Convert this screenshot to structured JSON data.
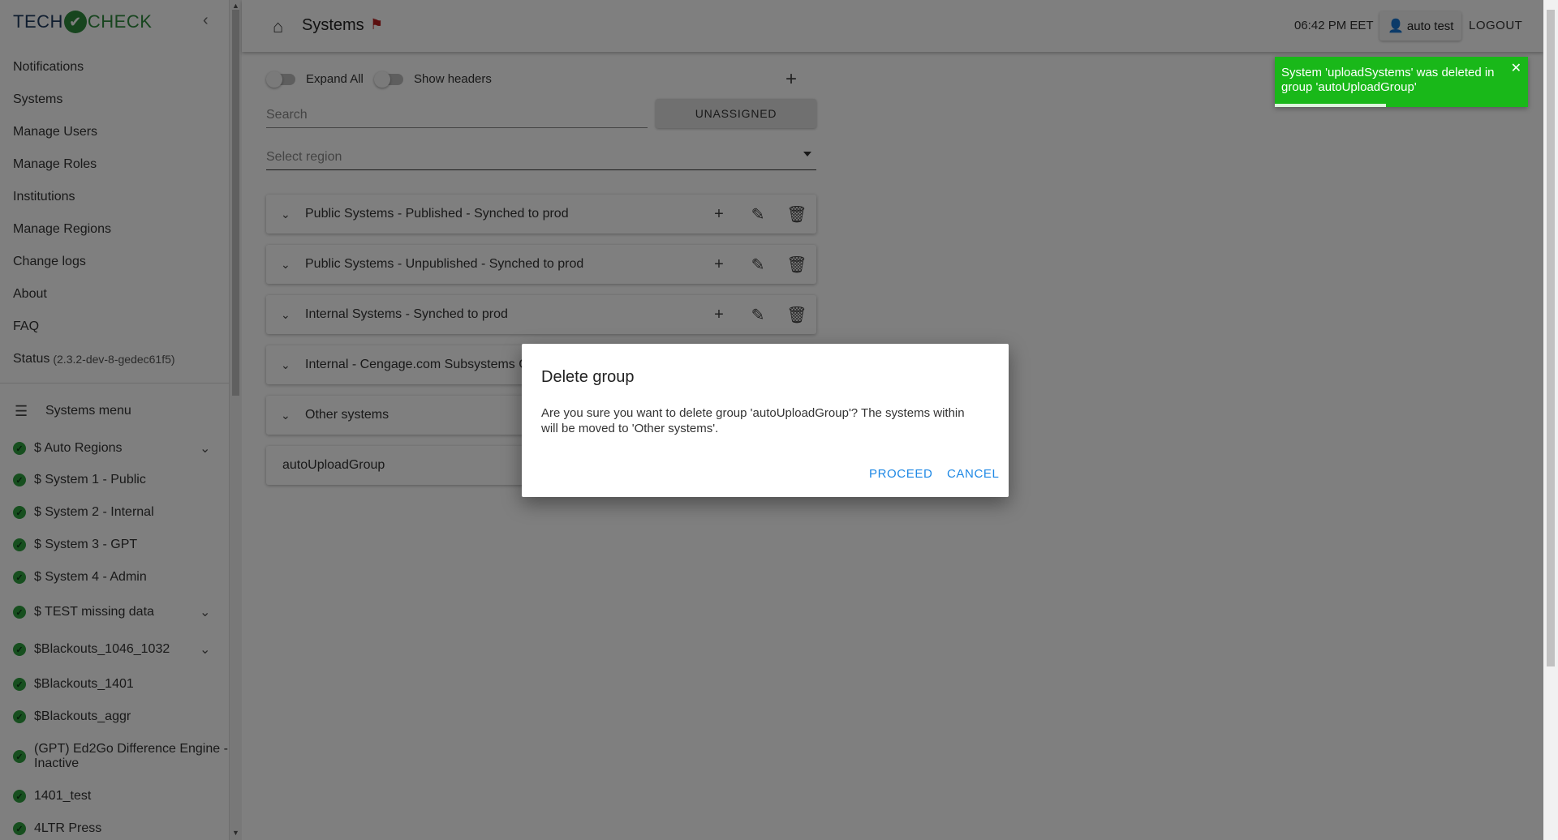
{
  "brand": {
    "part1": "TECH",
    "part2": "CHECK",
    "check_glyph": "✔"
  },
  "sidebar": {
    "nav": [
      {
        "label": "Notifications"
      },
      {
        "label": "Systems"
      },
      {
        "label": "Manage Users"
      },
      {
        "label": "Manage Roles"
      },
      {
        "label": "Institutions"
      },
      {
        "label": "Manage Regions"
      },
      {
        "label": "Change logs"
      },
      {
        "label": "About"
      },
      {
        "label": "FAQ"
      },
      {
        "label": "Status",
        "sub": "(2.3.2-dev-8-gedec61f5)"
      }
    ],
    "systems_menu_label": "Systems menu",
    "systems": [
      {
        "label": "$ Auto Regions",
        "expandable": true
      },
      {
        "label": "$ System 1 - Public",
        "expandable": false
      },
      {
        "label": "$ System 2 - Internal",
        "expandable": false
      },
      {
        "label": "$ System 3 - GPT",
        "expandable": false
      },
      {
        "label": "$ System 4 - Admin",
        "expandable": false
      },
      {
        "label": "$ TEST missing data",
        "expandable": true
      },
      {
        "label": "$Blackouts_1046_1032",
        "expandable": true
      },
      {
        "label": "$Blackouts_1401",
        "expandable": false
      },
      {
        "label": "$Blackouts_aggr",
        "expandable": false
      },
      {
        "label": "(GPT) Ed2Go Difference Engine - Inactive",
        "expandable": false
      },
      {
        "label": "1401_test",
        "expandable": false
      },
      {
        "label": "4LTR Press",
        "expandable": false
      }
    ]
  },
  "header": {
    "title": "Systems",
    "time": "06:42 PM EET",
    "user": "auto test",
    "logout": "LOGOUT"
  },
  "controls": {
    "expand_all": "Expand All",
    "show_headers": "Show headers",
    "search_placeholder": "Search",
    "unassigned": "UNASSIGNED",
    "region_placeholder": "Select region"
  },
  "groups": [
    {
      "label": "Public Systems - Published - Synched to prod",
      "actions": true,
      "chevron": true
    },
    {
      "label": "Public Systems - Unpublished - Synched to prod",
      "actions": true,
      "chevron": true
    },
    {
      "label": "Internal Systems - Synched to prod",
      "actions": true,
      "chevron": true
    },
    {
      "label": "Internal - Cengage.com Subsystems Gr",
      "actions": false,
      "chevron": true
    },
    {
      "label": "Other systems",
      "actions": false,
      "chevron": true
    },
    {
      "label": "autoUploadGroup",
      "actions": false,
      "chevron": false
    }
  ],
  "dialog": {
    "title": "Delete group",
    "message": "Are you sure you want to delete group 'autoUploadGroup'? The systems within will be moved to 'Other systems'.",
    "proceed": "PROCEED",
    "cancel": "CANCEL"
  },
  "toast": {
    "message": "System 'uploadSystems' was deleted in group 'autoUploadGroup'",
    "progress": 0.44
  },
  "colors": {
    "toast_bg": "#19b819",
    "dialog_button": "#1e88e5",
    "status_ok": "#2e9e3f",
    "flag": "#b71c1c"
  }
}
